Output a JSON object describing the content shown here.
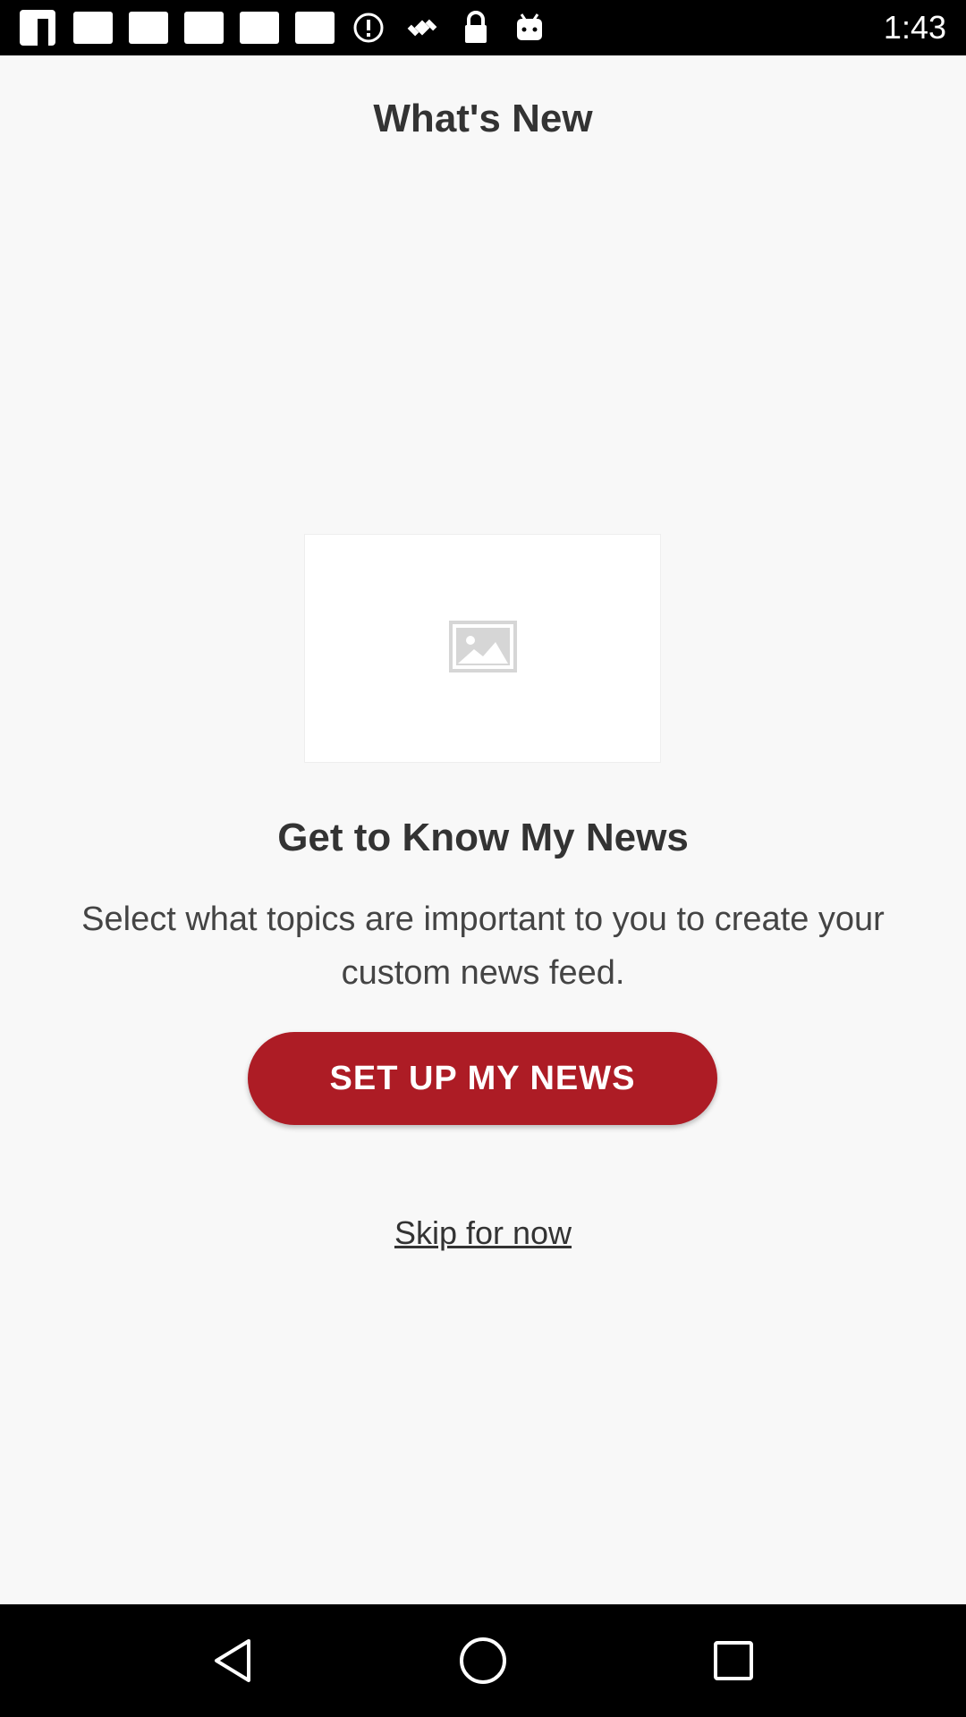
{
  "status_bar": {
    "time": "1:43",
    "icons": [
      "facebook-icon",
      "notification-square-icon",
      "notification-square-icon",
      "notification-square-icon",
      "notification-square-icon",
      "notification-square-icon",
      "info-circle-icon",
      "satellite-icon",
      "lock-icon",
      "android-icon"
    ]
  },
  "header": {
    "title": "What's New"
  },
  "main": {
    "image_icon": "image-placeholder-icon",
    "headline": "Get to Know My News",
    "description": "Select what topics are important to you to create your custom news feed.",
    "primary_button": "SET UP MY NEWS",
    "skip_link": "Skip for now"
  },
  "nav": {
    "icons": [
      "back-icon",
      "home-icon",
      "recents-icon"
    ]
  },
  "colors": {
    "accent": "#ad1c25",
    "background": "#f8f8f8",
    "text": "#333333"
  }
}
